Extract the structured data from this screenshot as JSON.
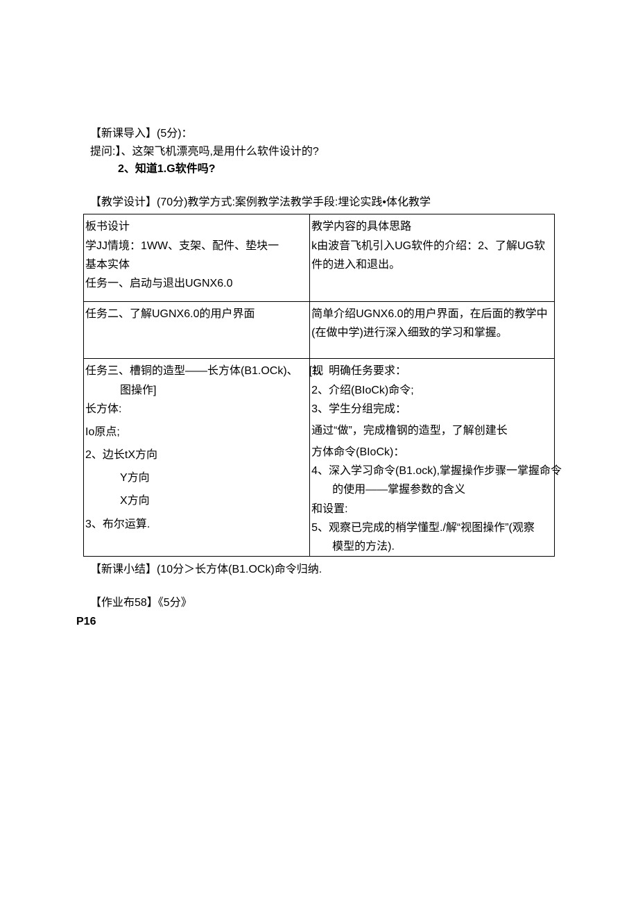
{
  "intro": {
    "title": "【新课导入】(5分)：",
    "q_label": "提问:】、这架飞机漂亮吗,是用什么软件设计的?",
    "q2": "2、知道1.G软件吗?"
  },
  "design": {
    "title": "【教学设计】(70分)教学方式:案例教学法教学手段:埋论实践•体化教学"
  },
  "row1": {
    "left": {
      "l1": "板书设计",
      "l2": "学JJ情境：1WW、支架、配件、垫块一",
      "l3": "基本实体",
      "l4": "任务一、启动与退出UGNX6.0"
    },
    "right": {
      "l1": "教学内容的具体思路",
      "l2": "k由波音飞机引入UG软件的介绍：2、了解UG软件的进入和退出。"
    }
  },
  "row2": {
    "left": {
      "l1": "任务二、了解UGNX6.0的用户界面"
    },
    "right": {
      "l1": "简单介绍UGNX6.0的用户界面，在后面的教学中(在做中学)进行深入细致的学习和掌握。"
    }
  },
  "row3": {
    "left": {
      "l1": "任务三、槽铜的造型——长方体(B1.OCk)、 [视",
      "l2": "图操作]",
      "l3": "长方体:",
      "l4": "Io原点;",
      "l5": "2、边长tX方向",
      "l6": "Y方向",
      "l7": "X方向",
      "l8": "3、布尔运算."
    },
    "right": {
      "l1": "1、明确任务要求：",
      "l2": "2、介绍(BIoCk)命令;",
      "l3": "3、学生分组完成：",
      "l4": "通过“做”，完成橹钢的造型，了解创建长",
      "l5": "方体命令(BIoCk)：",
      "l6": "4、深入学习命令(B1.ock),掌握操作步骤一掌握命令",
      "l7": "的使用——掌握参数的含义",
      "l8": "和设置:",
      "l9": "5、观察已完成的梢学懂型./解“视图操作”(观察",
      "l10": "模型的方法)."
    }
  },
  "summary": "【新课小结】(10分＞长方体(B1.OCk)命令归纳.",
  "hw": "【作业布58】《5分》",
  "p16": "P16"
}
